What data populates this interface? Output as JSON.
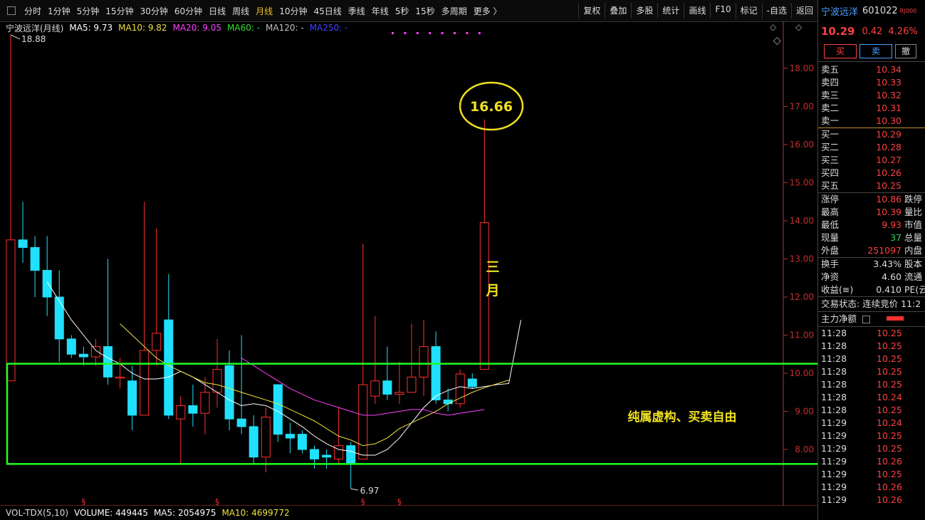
{
  "periods": [
    "分时",
    "1分钟",
    "5分钟",
    "15分钟",
    "30分钟",
    "60分钟",
    "日线",
    "周线",
    "月线",
    "10分钟",
    "45日线",
    "季线",
    "年线",
    "5秒",
    "15秒",
    "多周期",
    "更多 〉"
  ],
  "active_period_index": 8,
  "toolbar": [
    "复权",
    "叠加",
    "多股",
    "统计",
    "画线",
    "F10",
    "标记",
    "-自选",
    "返回"
  ],
  "ma_bar": {
    "title": "宁波远洋(月线)",
    "items": [
      {
        "label": "MA5: 9.73",
        "color": "#ffffff"
      },
      {
        "label": "MA10: 9.82",
        "color": "#f0e040"
      },
      {
        "label": "MA20: 9.05",
        "color": "#ff40ff"
      },
      {
        "label": "MA60: -",
        "color": "#30e030"
      },
      {
        "label": "MA120: -",
        "color": "#c0c0c0"
      },
      {
        "label": "MA250: -",
        "color": "#4040ff"
      }
    ]
  },
  "vol_bar": {
    "title": "VOL-TDX(5,10)",
    "items": [
      {
        "label": "VOLUME: 449445",
        "color": "#ffffff"
      },
      {
        "label": "MA5: 2054975",
        "color": "#ffffff"
      },
      {
        "label": "MA10: 4699772",
        "color": "#f0e040"
      }
    ]
  },
  "chart_data": {
    "type": "candlestick",
    "yaxis_ticks": [
      "18.00",
      "17.00",
      "16.00",
      "15.00",
      "14.00",
      "13.00",
      "12.00",
      "11.00",
      "10.00",
      "9.00",
      "8.00"
    ],
    "ylim": [
      7.0,
      18.0
    ],
    "high_label": "18.88",
    "low_label": "6.97",
    "peak_label": "16.66",
    "candles": [
      {
        "o": 9.8,
        "c": 13.5,
        "h": 18.88,
        "l": 9.8
      },
      {
        "o": 13.5,
        "c": 13.3,
        "h": 14.5,
        "l": 12.9
      },
      {
        "o": 13.3,
        "c": 12.7,
        "h": 13.6,
        "l": 12.0
      },
      {
        "o": 12.7,
        "c": 12.0,
        "h": 13.6,
        "l": 11.5
      },
      {
        "o": 12.0,
        "c": 10.9,
        "h": 12.7,
        "l": 10.3
      },
      {
        "o": 10.9,
        "c": 10.5,
        "h": 11.0,
        "l": 10.4
      },
      {
        "o": 10.5,
        "c": 10.43,
        "h": 10.7,
        "l": 10.2
      },
      {
        "o": 10.43,
        "c": 10.7,
        "h": 10.9,
        "l": 10.2
      },
      {
        "o": 10.7,
        "c": 9.9,
        "h": 13.0,
        "l": 9.7
      },
      {
        "o": 9.9,
        "c": 9.9,
        "h": 10.4,
        "l": 9.6
      },
      {
        "o": 9.8,
        "c": 8.9,
        "h": 10.2,
        "l": 8.5
      },
      {
        "o": 8.9,
        "c": 10.6,
        "h": 14.5,
        "l": 8.9
      },
      {
        "o": 10.6,
        "c": 11.05,
        "h": 13.8,
        "l": 10.2
      },
      {
        "o": 11.4,
        "c": 8.9,
        "h": 12.6,
        "l": 8.8
      },
      {
        "o": 8.8,
        "c": 9.15,
        "h": 9.4,
        "l": 7.6
      },
      {
        "o": 9.15,
        "c": 8.95,
        "h": 9.7,
        "l": 8.6
      },
      {
        "o": 8.95,
        "c": 9.5,
        "h": 9.9,
        "l": 8.4
      },
      {
        "o": 9.5,
        "c": 10.1,
        "h": 10.9,
        "l": 9.1
      },
      {
        "o": 10.2,
        "c": 8.8,
        "h": 10.6,
        "l": 8.5
      },
      {
        "o": 8.8,
        "c": 8.6,
        "h": 11.0,
        "l": 8.4
      },
      {
        "o": 8.6,
        "c": 7.8,
        "h": 8.9,
        "l": 7.6
      },
      {
        "o": 7.8,
        "c": 8.85,
        "h": 9.1,
        "l": 7.4
      },
      {
        "o": 9.7,
        "c": 8.4,
        "h": 9.7,
        "l": 8.2
      },
      {
        "o": 8.4,
        "c": 8.3,
        "h": 8.7,
        "l": 7.9
      },
      {
        "o": 8.4,
        "c": 8.0,
        "h": 8.5,
        "l": 7.9
      },
      {
        "o": 8.0,
        "c": 7.75,
        "h": 8.1,
        "l": 7.5
      },
      {
        "o": 7.85,
        "c": 7.8,
        "h": 8.0,
        "l": 7.5
      },
      {
        "o": 7.75,
        "c": 8.1,
        "h": 9.1,
        "l": 7.6
      },
      {
        "o": 8.1,
        "c": 7.65,
        "h": 8.2,
        "l": 6.97
      },
      {
        "o": 7.75,
        "c": 9.7,
        "h": 13.4,
        "l": 7.75
      },
      {
        "o": 9.4,
        "c": 9.8,
        "h": 11.5,
        "l": 9.2
      },
      {
        "o": 9.8,
        "c": 9.45,
        "h": 10.7,
        "l": 9.3
      },
      {
        "o": 9.45,
        "c": 9.5,
        "h": 10.3,
        "l": 9.2
      },
      {
        "o": 9.5,
        "c": 9.9,
        "h": 11.3,
        "l": 9.5
      },
      {
        "o": 9.9,
        "c": 10.7,
        "h": 11.4,
        "l": 9.4
      },
      {
        "o": 10.7,
        "c": 9.3,
        "h": 11.1,
        "l": 9.2
      },
      {
        "o": 9.3,
        "c": 9.2,
        "h": 9.6,
        "l": 9.0
      },
      {
        "o": 9.2,
        "c": 9.98,
        "h": 10.1,
        "l": 9.1
      },
      {
        "o": 9.85,
        "c": 9.65,
        "h": 10.0,
        "l": 9.6
      },
      {
        "o": 10.1,
        "c": 13.95,
        "h": 16.66,
        "l": 10.1
      }
    ],
    "ma_lines": [
      {
        "name": "MA5",
        "color": "#ffffff",
        "start": 3,
        "values": [
          12.4,
          11.9,
          11.4,
          11.0,
          10.6,
          10.4,
          10.25,
          10.0,
          9.85,
          9.85,
          9.9,
          10.05,
          9.9,
          9.7,
          9.5,
          9.3,
          9.15,
          9.2,
          9.15,
          9.0,
          8.8,
          8.6,
          8.35,
          8.15,
          8.0,
          7.95,
          7.85,
          7.85,
          8.0,
          8.3,
          8.7,
          9.1,
          9.4,
          9.55,
          9.65,
          9.6,
          9.65,
          9.7,
          9.73,
          11.4
        ]
      },
      {
        "name": "MA10",
        "color": "#f0e040",
        "start": 9,
        "values": [
          11.3,
          11.0,
          10.7,
          10.4,
          10.2,
          10.05,
          9.9,
          9.75,
          9.7,
          9.6,
          9.5,
          9.4,
          9.3,
          9.2,
          9.05,
          8.9,
          8.75,
          8.55,
          8.35,
          8.25,
          8.1,
          8.15,
          8.3,
          8.55,
          8.7,
          8.85,
          9.0,
          9.2,
          9.35,
          9.5,
          9.62,
          9.72,
          9.82
        ]
      },
      {
        "name": "MA20",
        "color": "#ff40ff",
        "start": 19,
        "values": [
          10.4,
          10.2,
          10.0,
          9.8,
          9.6,
          9.45,
          9.3,
          9.2,
          9.1,
          9.0,
          8.9,
          8.9,
          8.95,
          9.0,
          9.05,
          9.05,
          8.95,
          8.9,
          8.95,
          9.0,
          9.05
        ]
      }
    ],
    "zone": {
      "top": 10.25,
      "bottom": 7.62
    },
    "annotations": [
      "三",
      "月",
      "纯属虚构、买卖自由"
    ],
    "markers": [
      6,
      17,
      29,
      32
    ]
  },
  "quote": {
    "name": "宁波远洋",
    "code": "601022",
    "tag": "R|000",
    "price": "10.29",
    "change": "0.42",
    "pct": "4.26%",
    "buy": "买",
    "sell": "卖",
    "cancel": "撤"
  },
  "asks": [
    {
      "label": "卖五",
      "price": "10.34"
    },
    {
      "label": "卖四",
      "price": "10.33"
    },
    {
      "label": "卖三",
      "price": "10.32"
    },
    {
      "label": "卖二",
      "price": "10.31"
    },
    {
      "label": "卖一",
      "price": "10.30"
    }
  ],
  "bids": [
    {
      "label": "买一",
      "price": "10.29"
    },
    {
      "label": "买二",
      "price": "10.28"
    },
    {
      "label": "买三",
      "price": "10.27"
    },
    {
      "label": "买四",
      "price": "10.26"
    },
    {
      "label": "买五",
      "price": "10.25"
    }
  ],
  "stats": [
    {
      "label": "涨停",
      "value": "10.86",
      "color": "#ff4040",
      "right": "跌停"
    },
    {
      "label": "最高",
      "value": "10.39",
      "color": "#ff4040",
      "right": "量比"
    },
    {
      "label": "最低",
      "value": "9.93",
      "color": "#ff4040",
      "right": "市值"
    },
    {
      "label": "现量",
      "value": "37",
      "color": "#30d060",
      "right": "总量"
    },
    {
      "label": "外盘",
      "value": "251097",
      "color": "#ff4040",
      "right": "内盘"
    }
  ],
  "stats2": [
    {
      "label": "换手",
      "value": "3.43%",
      "color": "#dddddd",
      "right": "股本"
    },
    {
      "label": "净资",
      "value": "4.60",
      "color": "#dddddd",
      "right": "流通"
    },
    {
      "label": "收益(≡)",
      "value": "0.410",
      "color": "#dddddd",
      "right": "PE(云"
    }
  ],
  "trade_status": "交易状态: 连续竞价 11:2",
  "net_flow_label": "主力净额",
  "ticks": [
    {
      "t": "11:28",
      "p": "10.25"
    },
    {
      "t": "11:28",
      "p": "10.25"
    },
    {
      "t": "11:28",
      "p": "10.25"
    },
    {
      "t": "11:28",
      "p": "10.25"
    },
    {
      "t": "11:28",
      "p": "10.25"
    },
    {
      "t": "11:28",
      "p": "10.24"
    },
    {
      "t": "11:28",
      "p": "10.25"
    },
    {
      "t": "11:29",
      "p": "10.24"
    },
    {
      "t": "11:29",
      "p": "10.25"
    },
    {
      "t": "11:29",
      "p": "10.25"
    },
    {
      "t": "11:29",
      "p": "10.26"
    },
    {
      "t": "11:29",
      "p": "10.25"
    },
    {
      "t": "11:29",
      "p": "10.26"
    },
    {
      "t": "11:29",
      "p": "10.26"
    }
  ]
}
